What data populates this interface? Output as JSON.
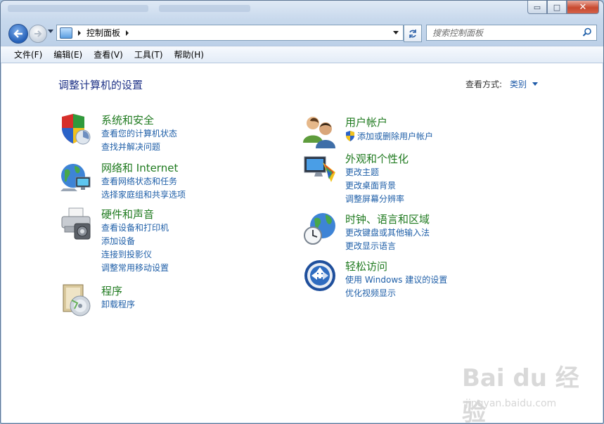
{
  "window": {
    "controls": {
      "minimize": "▭",
      "maximize": "□",
      "close": "✕"
    }
  },
  "nav": {
    "back_icon": "back-arrow-icon",
    "forward_icon": "forward-arrow-icon",
    "breadcrumb": "控制面板",
    "search_placeholder": "搜索控制面板",
    "refresh_icon": "refresh-icon"
  },
  "menu": [
    "文件(F)",
    "编辑(E)",
    "查看(V)",
    "工具(T)",
    "帮助(H)"
  ],
  "page": {
    "title": "调整计算机的设置",
    "view_by_label": "查看方式:",
    "view_by_value": "类别"
  },
  "categories": {
    "system": {
      "heading": "系统和安全",
      "links": [
        "查看您的计算机状态",
        "查找并解决问题"
      ]
    },
    "network": {
      "heading": "网络和 Internet",
      "links": [
        "查看网络状态和任务",
        "选择家庭组和共享选项"
      ]
    },
    "hardware": {
      "heading": "硬件和声音",
      "links": [
        "查看设备和打印机",
        "添加设备",
        "连接到投影仪",
        "调整常用移动设置"
      ]
    },
    "programs": {
      "heading": "程序",
      "links": [
        "卸载程序"
      ]
    },
    "users": {
      "heading": "用户帐户",
      "links": [
        "添加或删除用户帐户"
      ]
    },
    "appearance": {
      "heading": "外观和个性化",
      "links": [
        "更改主题",
        "更改桌面背景",
        "调整屏幕分辨率"
      ]
    },
    "clock": {
      "heading": "时钟、语言和区域",
      "links": [
        "更改键盘或其他输入法",
        "更改显示语言"
      ]
    },
    "ease": {
      "heading": "轻松访问",
      "links": [
        "使用 Windows 建议的设置",
        "优化视频显示"
      ]
    }
  },
  "watermark": {
    "brand": "Bai du 经验",
    "url": "jingyan.baidu.com"
  }
}
